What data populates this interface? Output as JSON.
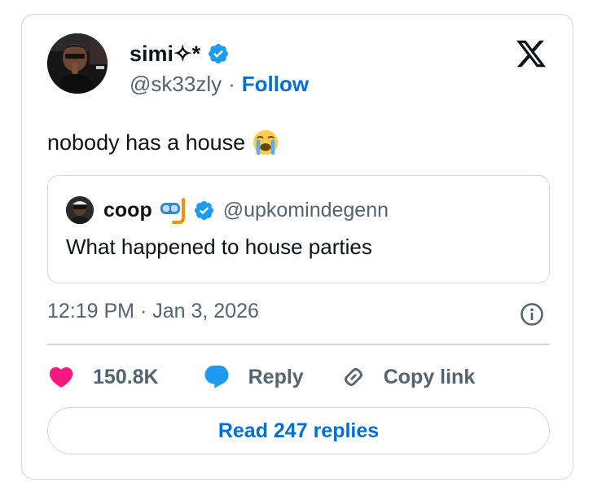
{
  "author": {
    "display_name": "simi✧*",
    "handle": "@sk33zly",
    "separator": "·",
    "follow_label": "Follow"
  },
  "tweet": {
    "text": "nobody has a house",
    "emoji": "loudly-crying-face"
  },
  "quoted": {
    "display_name": "coop",
    "emoji": "diving-mask",
    "handle": "@upkomindegenn",
    "text": "What happened to house parties"
  },
  "meta": {
    "timestamp": "12:19 PM · Jan 3, 2026"
  },
  "actions": {
    "like_count": "150.8K",
    "reply_label": "Reply",
    "copy_link_label": "Copy link"
  },
  "read_replies_label": "Read 247 replies",
  "colors": {
    "accent": "#006fd6",
    "verified": "#1d9bf0",
    "like": "#f91880",
    "secondary_text": "#536471",
    "border": "#cfd9de"
  },
  "icons": [
    "verified-badge-icon",
    "x-logo-icon",
    "info-icon",
    "heart-icon",
    "reply-bubble-icon",
    "link-icon"
  ]
}
